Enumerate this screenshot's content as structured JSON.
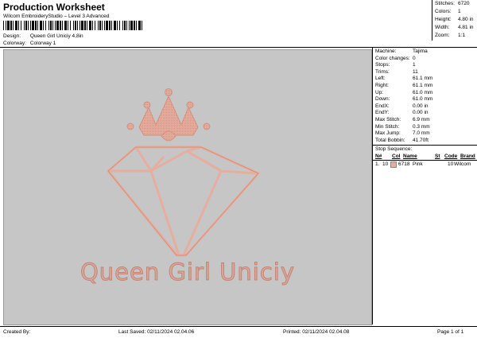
{
  "header": {
    "title": "Production Worksheet",
    "subtitle": "Wilcom EmbroideryStudio – Level 3 Advanced",
    "barcode_text": "",
    "design_label": "Design:",
    "design_value": "Queen Girl Uniciy 4,8in",
    "colorway_label": "Colorway:",
    "colorway_value": "Colorway 1"
  },
  "stats": [
    {
      "key": "Stitches:",
      "value": "6720"
    },
    {
      "key": "Colors:",
      "value": "1"
    },
    {
      "key": "Height:",
      "value": "4.80 in"
    },
    {
      "key": "Width:",
      "value": "4.81 in"
    },
    {
      "key": "Zoom:",
      "value": "1:1"
    }
  ],
  "design": {
    "text": "Queen Girl Uniciy",
    "thread_color": "#e6ae9f",
    "outline_color": "#c98875",
    "background": "#c6c6c6"
  },
  "machine_info": [
    {
      "key": "Machine:",
      "value": "Tajima"
    },
    {
      "key": "Color changes:",
      "value": "0"
    },
    {
      "key": "Stops:",
      "value": "1"
    },
    {
      "key": "Trims:",
      "value": "11"
    },
    {
      "key": "Left:",
      "value": "61.1 mm"
    },
    {
      "key": "Right:",
      "value": "61.1 mm"
    },
    {
      "key": "Up:",
      "value": "61.0 mm"
    },
    {
      "key": "Down:",
      "value": "61.0 mm"
    },
    {
      "key": "EndX:",
      "value": "0.00 in"
    },
    {
      "key": "EndY:",
      "value": "0.00 in"
    },
    {
      "key": "Max Stitch:",
      "value": "6.9 mm"
    },
    {
      "key": "Min Stitch:",
      "value": "0.3 mm"
    },
    {
      "key": "Max Jump:",
      "value": "7.0 mm"
    },
    {
      "key": "Total Bobbin:",
      "value": "41.70ft"
    }
  ],
  "stop_sequence": {
    "label": "Stop Sequence:",
    "columns": [
      "N#",
      "Col",
      "Name",
      "St",
      "Code",
      "Brand"
    ],
    "rows": [
      {
        "index": "1.",
        "n": "10",
        "color": "#e6ae9f",
        "code": "6718",
        "name": "Pink",
        "st": "10",
        "brand": "Wilcom"
      }
    ]
  },
  "footer": {
    "created": "Created By:",
    "last_saved": "Last Saved: 02/11/2024 02.04.06",
    "printed": "Printed: 02/11/2024 02.04.08",
    "page": "Page 1 of 1"
  }
}
